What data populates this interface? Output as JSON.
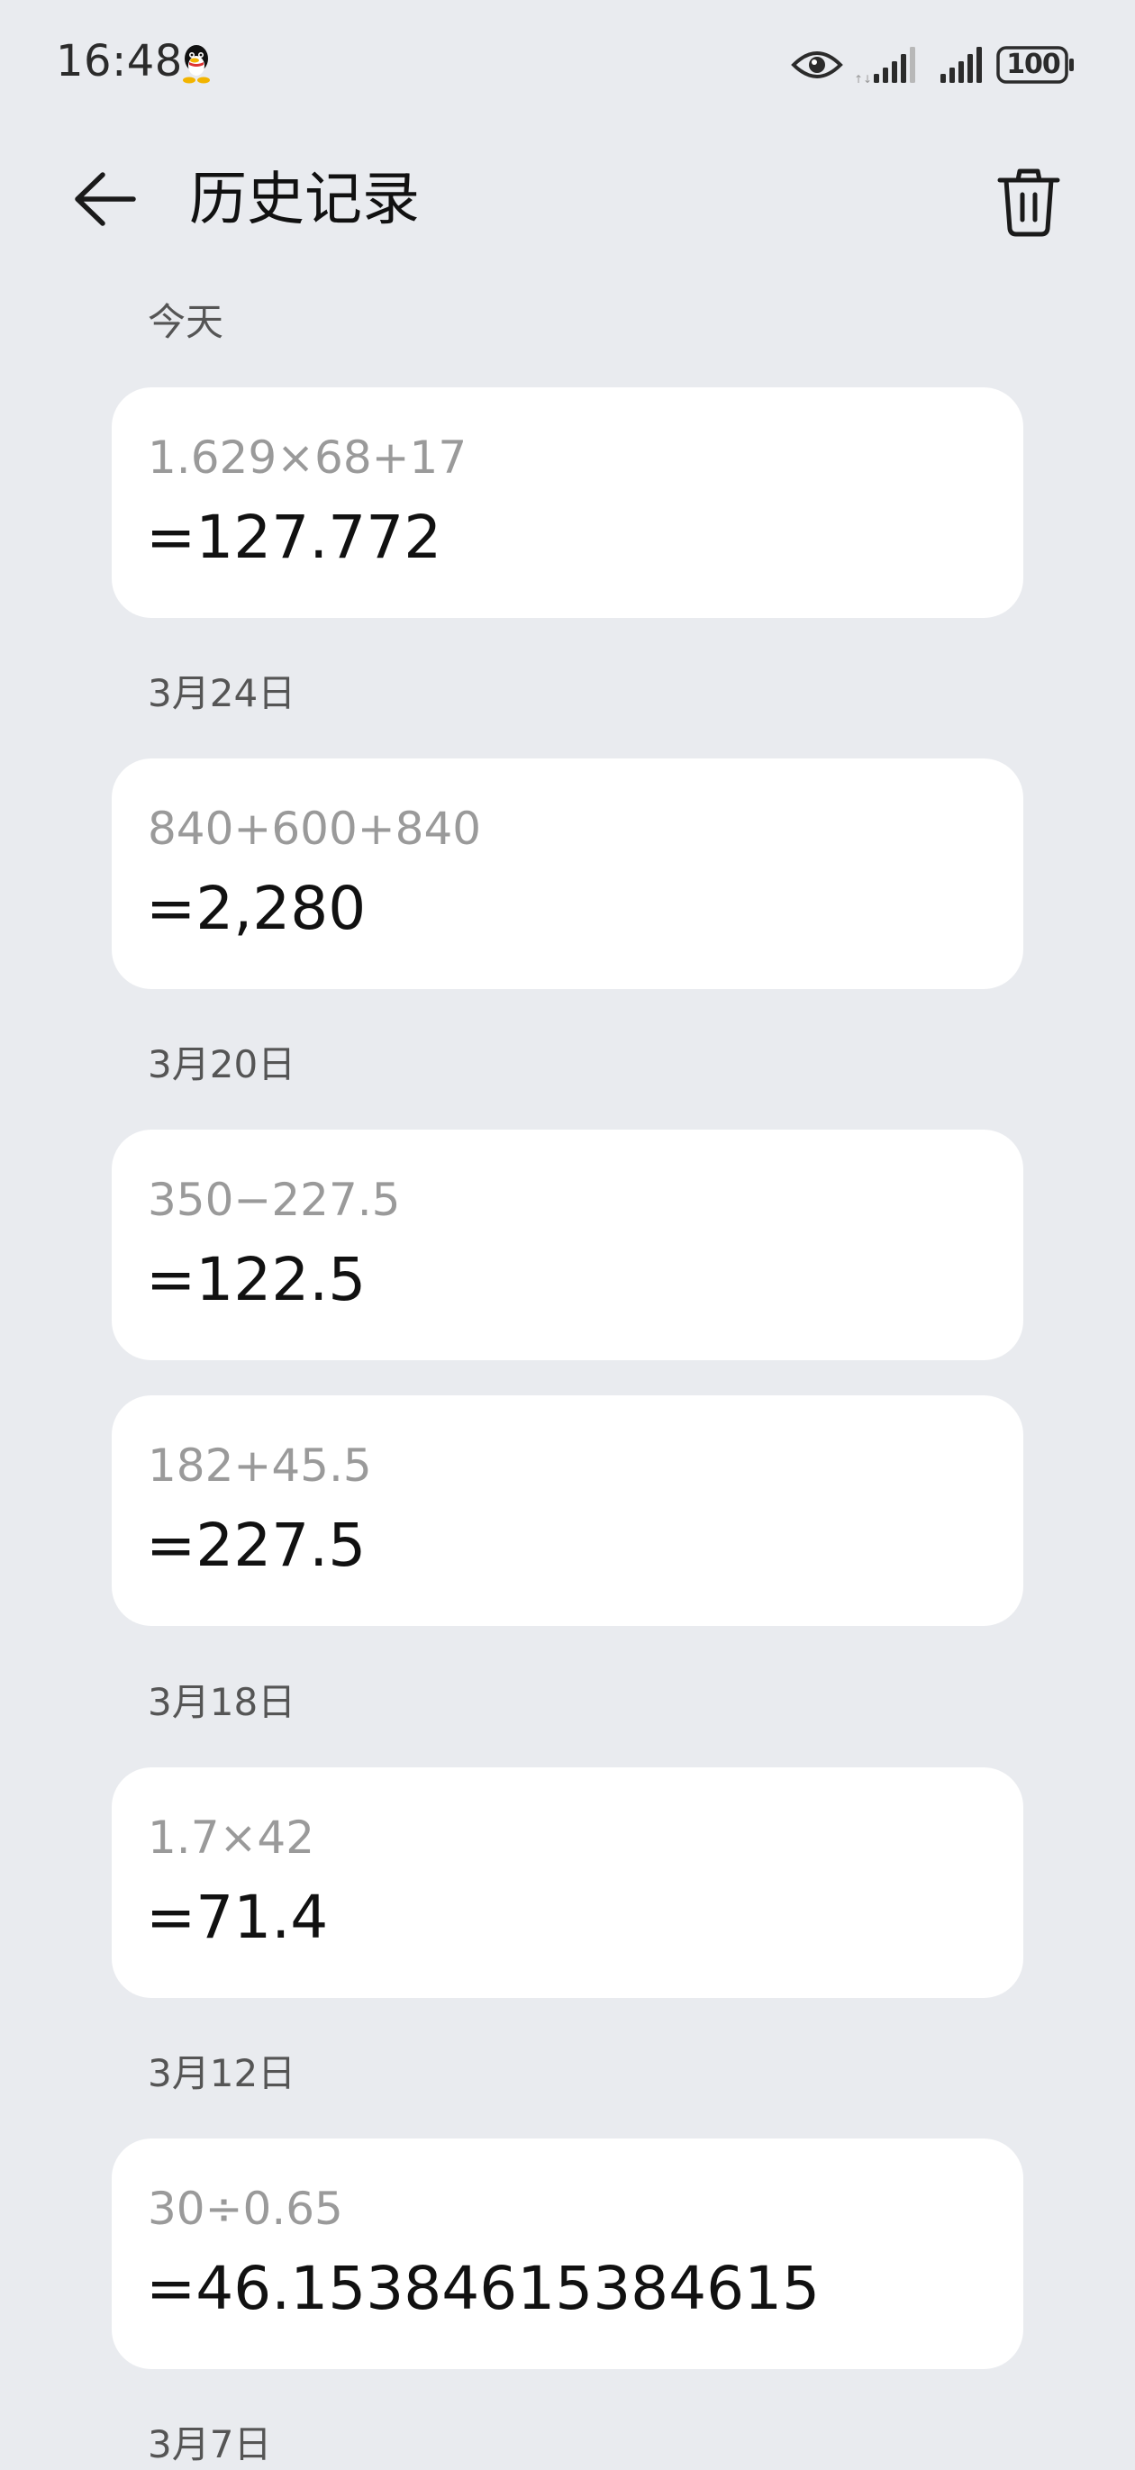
{
  "status_bar": {
    "time": "16:48",
    "battery": "100",
    "icons": [
      "qq-icon",
      "eye-icon",
      "signal-icon",
      "signal-icon",
      "battery-icon"
    ]
  },
  "header": {
    "title": "历史记录",
    "back_icon": "back-arrow-icon",
    "delete_icon": "trash-icon"
  },
  "groups": [
    {
      "label": "今天",
      "entries": [
        {
          "expression": "1.629×68+17",
          "result": "=127.772"
        }
      ]
    },
    {
      "label": "3月24日",
      "entries": [
        {
          "expression": "840+600+840",
          "result": "=2,280"
        }
      ]
    },
    {
      "label": "3月20日",
      "entries": [
        {
          "expression": "350−227.5",
          "result": "=122.5"
        },
        {
          "expression": "182+45.5",
          "result": "=227.5"
        }
      ]
    },
    {
      "label": "3月18日",
      "entries": [
        {
          "expression": "1.7×42",
          "result": "=71.4"
        }
      ]
    },
    {
      "label": "3月12日",
      "entries": [
        {
          "expression": "30÷0.65",
          "result": "=46.1538461538461​5"
        }
      ]
    },
    {
      "label": "3月7日",
      "entries": []
    }
  ]
}
